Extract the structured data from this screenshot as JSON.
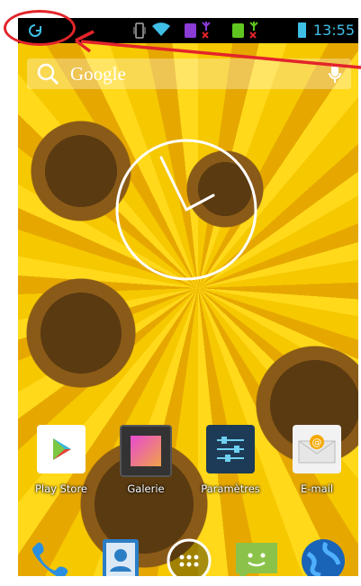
{
  "statusbar": {
    "time": "13:55",
    "icons": [
      "sync-icon",
      "vibrate-icon",
      "wifi-icon",
      "sim-1-icon",
      "signal-1-icon",
      "sim-2-icon",
      "signal-2-icon",
      "battery-icon"
    ]
  },
  "search": {
    "label": "Google"
  },
  "apps": [
    {
      "label": "Play Store"
    },
    {
      "label": "Galerie"
    },
    {
      "label": "Paramètres"
    },
    {
      "label": "E-mail"
    }
  ],
  "dock": [
    "phone-icon",
    "contacts-icon",
    "app-drawer-icon",
    "messaging-icon",
    "browser-icon"
  ],
  "colors": {
    "accent": "#3fbfe6",
    "annotation": "#e3242b",
    "wallpaper": "#f2b800"
  }
}
